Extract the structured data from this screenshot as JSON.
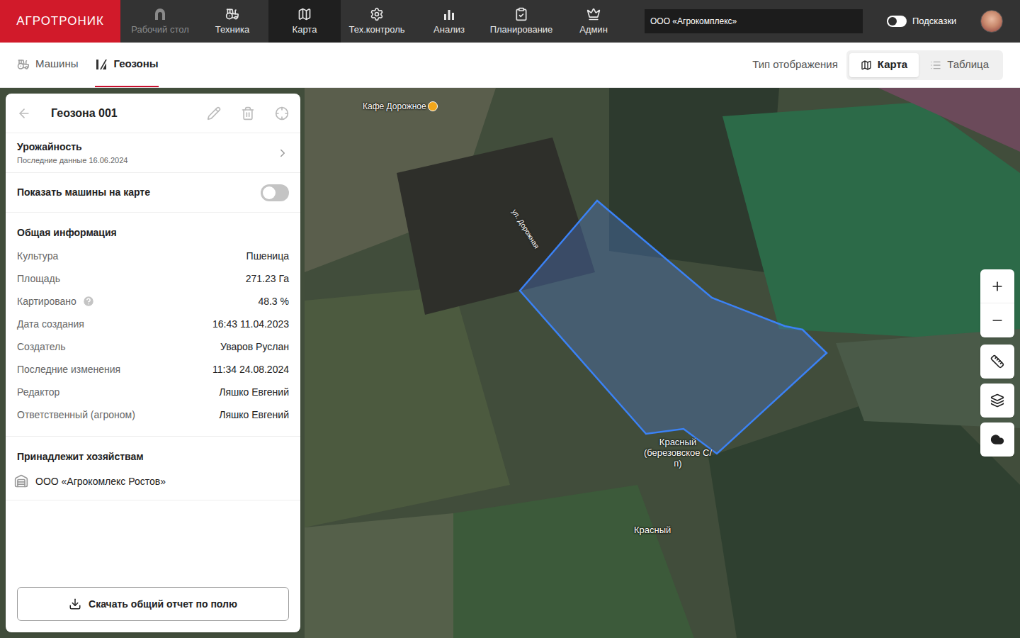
{
  "nav": {
    "logo": "АГРОТРОНИК",
    "items": [
      {
        "label": "Рабочий стол",
        "selected": false,
        "disabled": true
      },
      {
        "label": "Техника",
        "selected": false,
        "disabled": false
      },
      {
        "label": "Карта",
        "selected": true,
        "disabled": false
      },
      {
        "label": "Тех.контроль",
        "selected": false,
        "disabled": false
      },
      {
        "label": "Анализ",
        "selected": false,
        "disabled": false
      },
      {
        "label": "Планирование",
        "selected": false,
        "disabled": false
      },
      {
        "label": "Админ",
        "selected": false,
        "disabled": false
      }
    ]
  },
  "company": "ООО «Агрокомплекс»",
  "hints": {
    "label": "Подсказки",
    "on": false
  },
  "subnav": {
    "tabs": [
      {
        "label": "Машины",
        "selected": false
      },
      {
        "label": "Геозоны",
        "selected": true
      }
    ],
    "display_type": {
      "label": "Тип отображения",
      "options": [
        {
          "label": "Карта",
          "selected": true
        },
        {
          "label": "Таблица",
          "selected": false
        }
      ]
    }
  },
  "panel": {
    "title": "Геозона 001",
    "yield": {
      "title": "Урожайность",
      "subtitle": "Последние данные 16.06.2024"
    },
    "show_machines": {
      "label": "Показать машины на карте",
      "on": false
    },
    "info": {
      "title": "Общая информация",
      "rows": [
        {
          "label": "Культура",
          "value": "Пшеница",
          "help": false
        },
        {
          "label": "Площадь",
          "value": "271.23 Га",
          "help": false
        },
        {
          "label": "Картировано",
          "value": "48.3 %",
          "help": true
        },
        {
          "label": "Дата создания",
          "value": "16:43 11.04.2023",
          "help": false
        },
        {
          "label": "Создатель",
          "value": "Уваров Руслан",
          "help": false
        },
        {
          "label": "Последние изменения",
          "value": "11:34 24.08.2024",
          "help": false
        },
        {
          "label": "Редактор",
          "value": "Ляшко Евгений",
          "help": false
        },
        {
          "label": "Ответственный (агроном)",
          "value": "Ляшко Евгений",
          "help": false
        }
      ]
    },
    "farms": {
      "title": "Принадлежит хозяйствам",
      "items": [
        "ООО «Агрокомлекс Ростов»"
      ]
    },
    "download_button": "Скачать общий отчет по полю"
  },
  "map": {
    "labels": [
      {
        "text": "Кафе Дорожное",
        "kind": "poi"
      },
      {
        "text": "ул. Дорожная",
        "kind": "street"
      },
      {
        "text": "Красный (березовское С/п)",
        "kind": "settlement"
      },
      {
        "text": "Красный",
        "kind": "town"
      }
    ]
  }
}
